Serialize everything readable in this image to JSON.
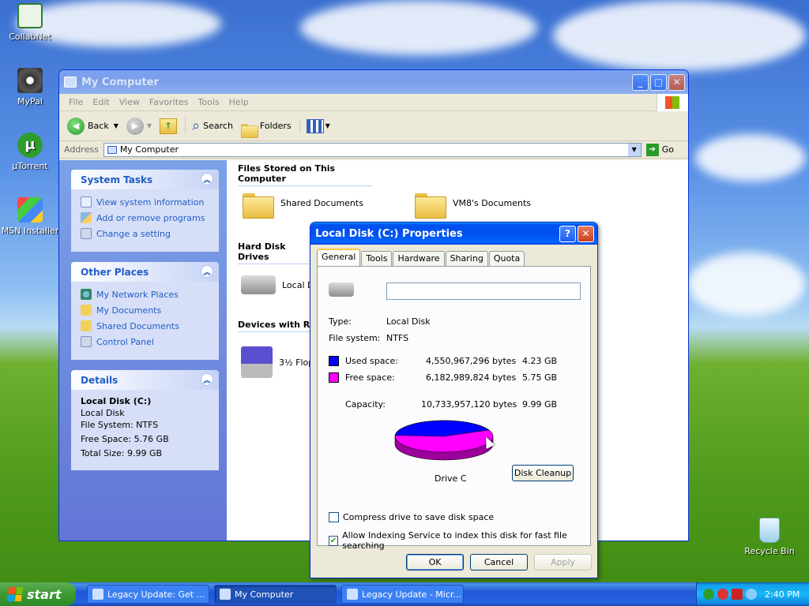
{
  "desktop": {
    "icons": [
      {
        "label": "CollabNet"
      },
      {
        "label": "MyPal"
      },
      {
        "label": "µTorrent"
      },
      {
        "label": "MSN Installer"
      },
      {
        "label": "Recycle Bin"
      }
    ]
  },
  "explorer": {
    "title": "My Computer",
    "menu": [
      "File",
      "Edit",
      "View",
      "Favorites",
      "Tools",
      "Help"
    ],
    "toolbar": {
      "back": "Back",
      "search": "Search",
      "folders": "Folders"
    },
    "address": {
      "label": "Address",
      "value": "My Computer",
      "go": "Go"
    },
    "system_tasks": {
      "title": "System Tasks",
      "items": [
        "View system information",
        "Add or remove programs",
        "Change a setting"
      ]
    },
    "other_places": {
      "title": "Other Places",
      "items": [
        "My Network Places",
        "My Documents",
        "Shared Documents",
        "Control Panel"
      ]
    },
    "details": {
      "title": "Details",
      "name": "Local Disk (C:)",
      "type": "Local Disk",
      "fs": "File System: NTFS",
      "free": "Free Space: 5.76 GB",
      "total": "Total Size: 9.99 GB"
    },
    "sections": {
      "files": "Files Stored on This Computer",
      "hdd": "Hard Disk Drives",
      "devices": "Devices with Re"
    },
    "items": {
      "shared": "Shared Documents",
      "vm8": "VM8's Documents",
      "localdisk": "Local Di",
      "floppy": "3½ Flop"
    }
  },
  "dialog": {
    "title": "Local Disk (C:) Properties",
    "tabs": [
      "General",
      "Tools",
      "Hardware",
      "Sharing",
      "Quota"
    ],
    "label_value": "",
    "type_label": "Type:",
    "type_value": "Local Disk",
    "fs_label": "File system:",
    "fs_value": "NTFS",
    "used_label": "Used space:",
    "used_bytes": "4,550,967,296 bytes",
    "used_gb": "4.23 GB",
    "free_label": "Free space:",
    "free_bytes": "6,182,989,824 bytes",
    "free_gb": "5.75 GB",
    "cap_label": "Capacity:",
    "cap_bytes": "10,733,957,120 bytes",
    "cap_gb": "9.99 GB",
    "drive_label": "Drive C",
    "cleanup": "Disk Cleanup",
    "compress": "Compress drive to save disk space",
    "indexing": "Allow Indexing Service to index this disk for fast file searching",
    "ok": "OK",
    "cancel": "Cancel",
    "apply": "Apply",
    "used_fraction": 0.424,
    "colors": {
      "used": "#0000ff",
      "free": "#ff00ff"
    }
  },
  "taskbar": {
    "start": "start",
    "items": [
      "Legacy Update: Get ...",
      "My Computer",
      "Legacy Update - Micr..."
    ],
    "clock": "2:40 PM"
  }
}
